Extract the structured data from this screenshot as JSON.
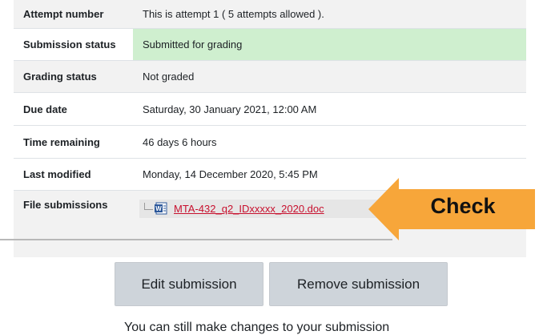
{
  "status_table": {
    "rows": [
      {
        "label": "Attempt number",
        "value": "This is attempt 1 ( 5 attempts allowed )."
      },
      {
        "label": "Submission status",
        "value": "Submitted for grading"
      },
      {
        "label": "Grading status",
        "value": "Not graded"
      },
      {
        "label": "Due date",
        "value": "Saturday, 30 January 2021, 12:00 AM"
      },
      {
        "label": "Time remaining",
        "value": "46 days 6 hours"
      },
      {
        "label": "Last modified",
        "value": "Monday, 14 December 2020, 5:45 PM"
      },
      {
        "label": "File submissions",
        "value": ""
      }
    ]
  },
  "file_submission": {
    "filename": "MTA-432_q2_IDxxxxx_2020.doc",
    "icon": "word-document-icon",
    "link_color": "#c8102e"
  },
  "callout": {
    "text": "Check",
    "color": "#f7a63a"
  },
  "actions": {
    "edit_label": "Edit submission",
    "remove_label": "Remove submission"
  },
  "footer": {
    "note": "You can still make changes to your submission"
  },
  "colors": {
    "submitted_bg": "#cfefcf",
    "row_alt_bg": "#f2f2f2",
    "button_bg": "#ced4da"
  }
}
